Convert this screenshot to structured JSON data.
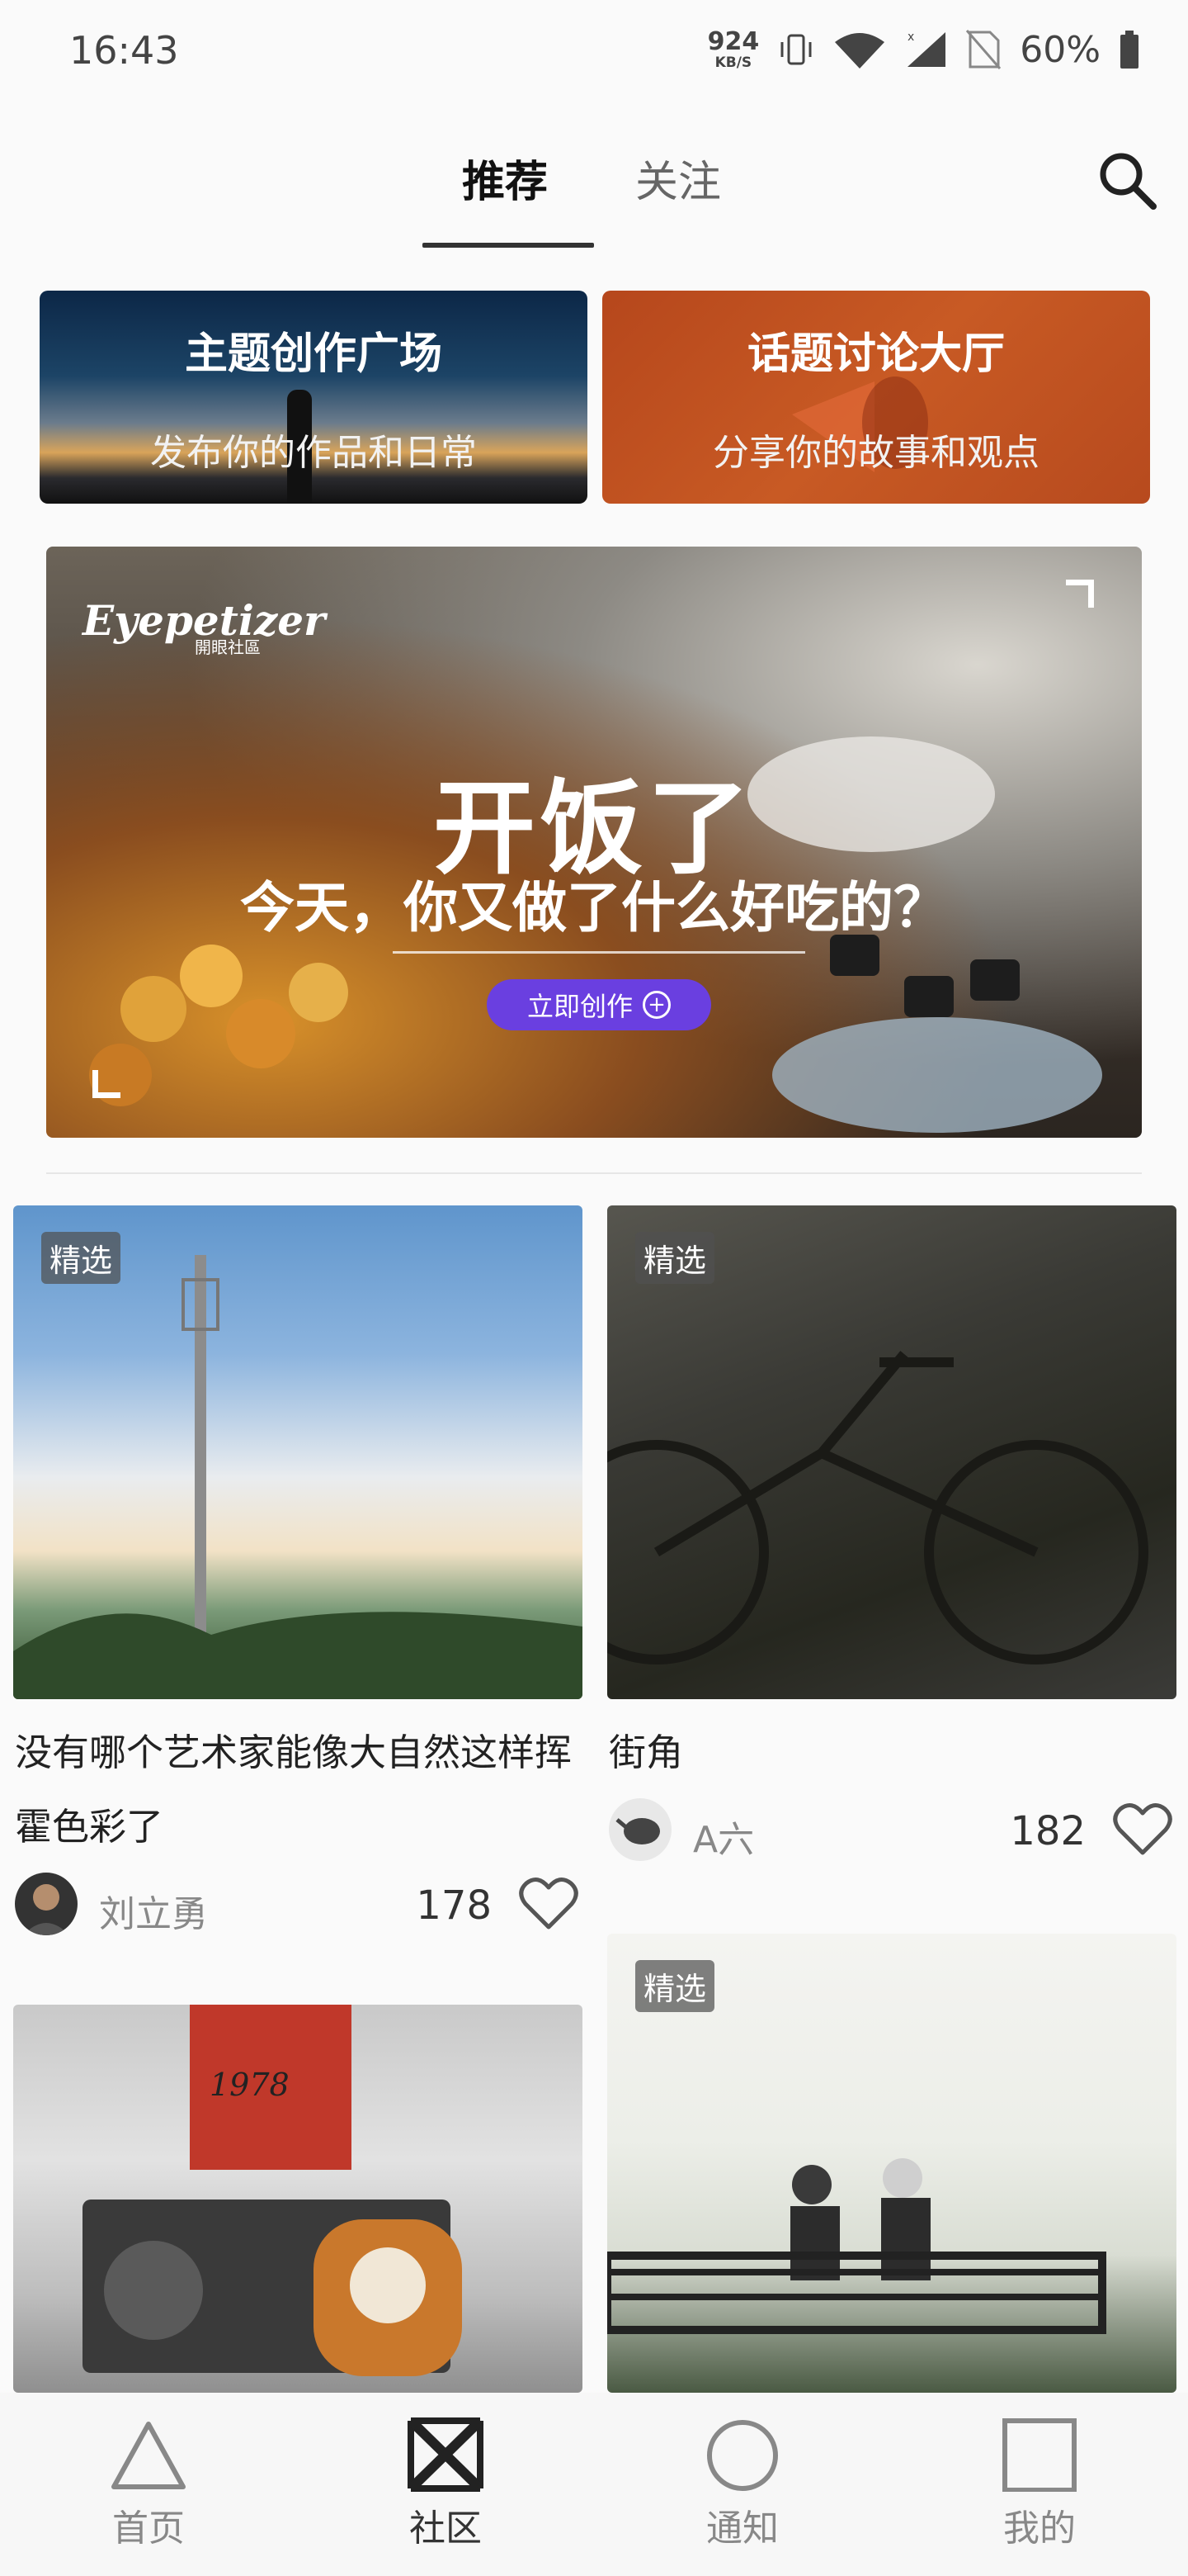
{
  "status_bar": {
    "time": "16:43",
    "net_speed_value": "924",
    "net_speed_unit": "KB/S",
    "battery_percent": "60%",
    "icons": [
      "vibrate-icon",
      "wifi-icon",
      "cell-signal-icon",
      "no-sim-icon",
      "battery-icon"
    ]
  },
  "tabs": {
    "items": [
      {
        "label": "推荐",
        "active": true
      },
      {
        "label": "关注",
        "active": false
      }
    ],
    "search_icon": "search-icon"
  },
  "categories": [
    {
      "title": "主题创作广场",
      "subtitle": "发布你的作品和日常"
    },
    {
      "title": "话题讨论大厅",
      "subtitle": "分享你的故事和观点"
    }
  ],
  "banner": {
    "logo": "Eyepetizer",
    "logo_sub": "開眼社區",
    "title": "开饭了",
    "subtitle": "今天，你又做了什么好吃的？",
    "cta_label": "立即创作",
    "cta_color": "#6a3fe0"
  },
  "feed": [
    {
      "badge": "精选",
      "title": "没有哪个艺术家能像大自然这样挥霍色彩了",
      "author": "刘立勇",
      "likes": "178"
    },
    {
      "badge": "精选",
      "title": "街角",
      "author": "A六",
      "likes": "182"
    },
    {
      "badge": "",
      "title": "",
      "author": "",
      "likes": ""
    },
    {
      "badge": "精选",
      "title": "",
      "author": "",
      "likes": ""
    }
  ],
  "bottom_nav": {
    "items": [
      {
        "label": "首页",
        "icon": "triangle-icon",
        "active": false
      },
      {
        "label": "社区",
        "icon": "x-square-icon",
        "active": true
      },
      {
        "label": "通知",
        "icon": "circle-icon",
        "active": false
      },
      {
        "label": "我的",
        "icon": "square-icon",
        "active": false
      }
    ]
  }
}
